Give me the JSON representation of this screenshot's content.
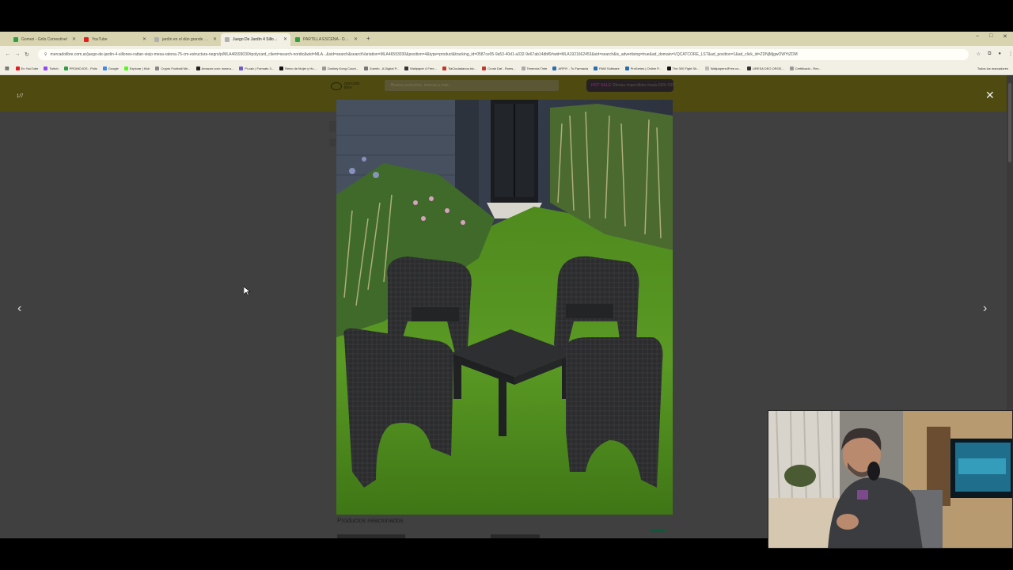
{
  "browser": {
    "tabs": [
      {
        "title": "Gomeri - Grilo Comestível",
        "active": false,
        "favicon": "#2ea043"
      },
      {
        "title": "YouTube",
        "active": false,
        "favicon": "#e02020"
      },
      {
        "title": "jardín en el dún grande - Busc",
        "active": false,
        "favicon": "#b0b0b0"
      },
      {
        "title": "Juego De Jardín 4 Sillones Rattan",
        "active": true,
        "favicon": "#b0b0b0"
      },
      {
        "title": "PARTILLA ESCENA - Dashboard",
        "active": false,
        "favicon": "#2ea043"
      }
    ],
    "new_tab_glyph": "+",
    "url": "mercadolibre.com.ar/juego-de-jardin-4-sillones-rattan-viejo-mesa-ratona-75-cm-estructura-negro/p/MLA46593030#polycard_client=search-nordic&wid=MLA...&sid=search&searchVariation=MLA46593030&position=4&type=product&tracking_id=0587ce05-9a53-40d1-a332-9e67ab14dbf6#wid=MLA1921662453&sid=search&is_advertising=true&ad_domain=VQCATCORE_LST&ad_position=1&ad_click_id=ZDNjMjgwOWYtZDM",
    "bookmarks": [
      "En YouTube",
      "Twitch",
      "PROMOJOS - Polis",
      "Google",
      "Explorar | Kick",
      "Crypto Football Me...",
      "Amazon.com: www.a...",
      "Pi-calc | Formato 3...",
      "Reino de Mujer y Hu...",
      "Donkey Kong Count...",
      "Zuenfo - A Digital P...",
      "Wallpaper 4 Free...",
      "TiaCiudadanos.hiz...",
      "Cronk Daf - Roms...",
      "Tenencia Tinte",
      "ARPIY - Tu Farmacia",
      "PAW Software",
      "ProSeries | Online P...",
      "The 300 Fight Sh...",
      "Wallpapers4Free.co...",
      "LIRESA DEO ORGE...",
      "Certificado - Rev..."
    ],
    "bookmarks_all": "Todos los marcadores"
  },
  "site": {
    "logo_line1": "mercado",
    "logo_line2": "libre",
    "search_placeholder": "Buscar productos, marcas y más...",
    "promo_badge": "HOT SALE",
    "promo_text": "Ofertas imperdibles hasta 50% OFF",
    "related_title": "Productos relacionados"
  },
  "lightbox": {
    "counter": "1/7",
    "close_glyph": "✕",
    "prev_glyph": "‹",
    "next_glyph": "›",
    "image_alt": "Juego de jardín 4 sillones rattan con mesa ratona sobre césped"
  },
  "colors": {
    "header": "#4e4a10",
    "overlay": "#404040",
    "tab_strip": "#d9d4b0"
  }
}
